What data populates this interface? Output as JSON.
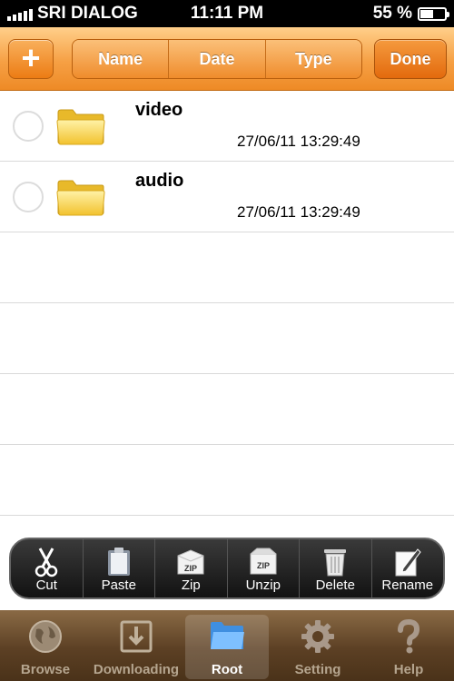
{
  "status_bar": {
    "carrier": "SRI DIALOG",
    "time": "11:11 PM",
    "battery": "55 %",
    "battery_level": 0.55
  },
  "toolbar": {
    "add_label": "+",
    "sort_options": [
      "Name",
      "Date",
      "Type"
    ],
    "selected_sort": "Date",
    "done_label": "Done"
  },
  "files": [
    {
      "name": "video",
      "date": "27/06/11 13:29:49",
      "icon": "folder-icon"
    },
    {
      "name": "audio",
      "date": "27/06/11 13:29:49",
      "icon": "folder-icon"
    }
  ],
  "actions": [
    {
      "label": "Cut",
      "icon": "scissors-icon"
    },
    {
      "label": "Paste",
      "icon": "clipboard-icon"
    },
    {
      "label": "Zip",
      "icon": "zip-icon"
    },
    {
      "label": "Unzip",
      "icon": "unzip-icon"
    },
    {
      "label": "Delete",
      "icon": "trash-icon"
    },
    {
      "label": "Rename",
      "icon": "pencil-icon"
    }
  ],
  "tabs": [
    {
      "label": "Browse",
      "icon": "globe-icon",
      "active": false
    },
    {
      "label": "Downloading",
      "icon": "download-icon",
      "active": false
    },
    {
      "label": "Root",
      "icon": "folder-icon",
      "active": true
    },
    {
      "label": "Setting",
      "icon": "gear-icon",
      "active": false
    },
    {
      "label": "Help",
      "icon": "question-icon",
      "active": false
    }
  ],
  "colors": {
    "toolbar_orange": "#f6a044",
    "done_orange": "#e36a0d",
    "tabbar_brown": "#5c4024",
    "folder_yellow": "#f9d64c"
  }
}
